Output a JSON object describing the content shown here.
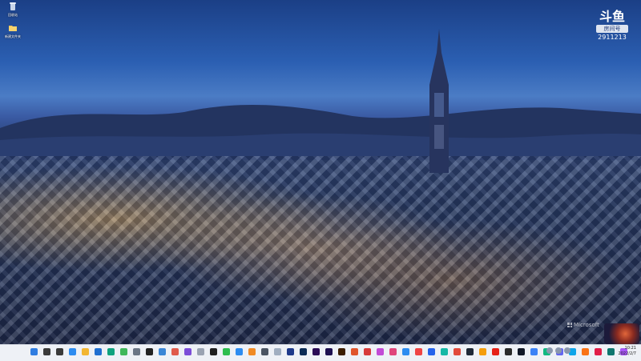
{
  "desktop": {
    "icons": [
      {
        "name": "recycle-bin-icon",
        "label": "回收站",
        "color": "#9fb6d8"
      },
      {
        "name": "folder-icon",
        "label": "新建文件夹",
        "color": "#f3c34a"
      }
    ]
  },
  "watermark": {
    "logo": "斗鱼",
    "tag": "房间号",
    "room_id": "2911213"
  },
  "microsoft_mark": {
    "label": "Microsoft"
  },
  "taskbar": {
    "items": [
      {
        "name": "start-icon",
        "color": "#2f7de1"
      },
      {
        "name": "search-icon",
        "color": "#3a3a3a"
      },
      {
        "name": "task-view-icon",
        "color": "#3a3a3a"
      },
      {
        "name": "widgets-icon",
        "color": "#2d8cf0"
      },
      {
        "name": "file-explorer-icon",
        "color": "#f2b632"
      },
      {
        "name": "store-icon",
        "color": "#1f6fd0"
      },
      {
        "name": "edge-icon",
        "color": "#0fa27e"
      },
      {
        "name": "app-icon",
        "color": "#3fb75a"
      },
      {
        "name": "settings-icon",
        "color": "#6b7685"
      },
      {
        "name": "camera-icon",
        "color": "#222222"
      },
      {
        "name": "app-icon",
        "color": "#3a86d6"
      },
      {
        "name": "app-icon",
        "color": "#e05b4c"
      },
      {
        "name": "app-icon",
        "color": "#7c4dd8"
      },
      {
        "name": "app-icon",
        "color": "#9aa3b2"
      },
      {
        "name": "qq-icon",
        "color": "#1f1f1f"
      },
      {
        "name": "wechat-icon",
        "color": "#2dbd4e"
      },
      {
        "name": "app-icon",
        "color": "#2d8cf0"
      },
      {
        "name": "app-icon",
        "color": "#f08a24"
      },
      {
        "name": "app-icon",
        "color": "#4b5563"
      },
      {
        "name": "app-icon",
        "color": "#a0aec0"
      },
      {
        "name": "app-icon",
        "color": "#1e3a8a"
      },
      {
        "name": "photoshop-icon",
        "color": "#0b2b55"
      },
      {
        "name": "premiere-icon",
        "color": "#2a0b55"
      },
      {
        "name": "after-effects-icon",
        "color": "#1d1050"
      },
      {
        "name": "illustrator-icon",
        "color": "#3b1d00"
      },
      {
        "name": "app-icon",
        "color": "#e0552b"
      },
      {
        "name": "app-icon",
        "color": "#d73b3b"
      },
      {
        "name": "app-icon",
        "color": "#c24bd6"
      },
      {
        "name": "app-icon",
        "color": "#e0457b"
      },
      {
        "name": "app-icon",
        "color": "#2d8cf0"
      },
      {
        "name": "app-icon",
        "color": "#ef4444"
      },
      {
        "name": "app-icon",
        "color": "#2563eb"
      },
      {
        "name": "app-icon",
        "color": "#14b8a6"
      },
      {
        "name": "chrome-icon",
        "color": "#e24a3b"
      },
      {
        "name": "app-icon",
        "color": "#1f2937"
      },
      {
        "name": "app-icon",
        "color": "#f59e0b"
      },
      {
        "name": "youtube-icon",
        "color": "#e62117"
      },
      {
        "name": "app-icon",
        "color": "#2b2b2b"
      },
      {
        "name": "app-icon",
        "color": "#111827"
      },
      {
        "name": "app-icon",
        "color": "#3b82f6"
      },
      {
        "name": "app-icon",
        "color": "#10b981"
      },
      {
        "name": "app-icon",
        "color": "#6366f1"
      },
      {
        "name": "app-icon",
        "color": "#0ea5e9"
      },
      {
        "name": "app-icon",
        "color": "#f97316"
      },
      {
        "name": "app-icon",
        "color": "#e11d48"
      },
      {
        "name": "app-icon",
        "color": "#0f766e"
      },
      {
        "name": "app-icon",
        "color": "#a855f7"
      }
    ],
    "clock_time": "10:21",
    "clock_date": "2022/2/7"
  }
}
